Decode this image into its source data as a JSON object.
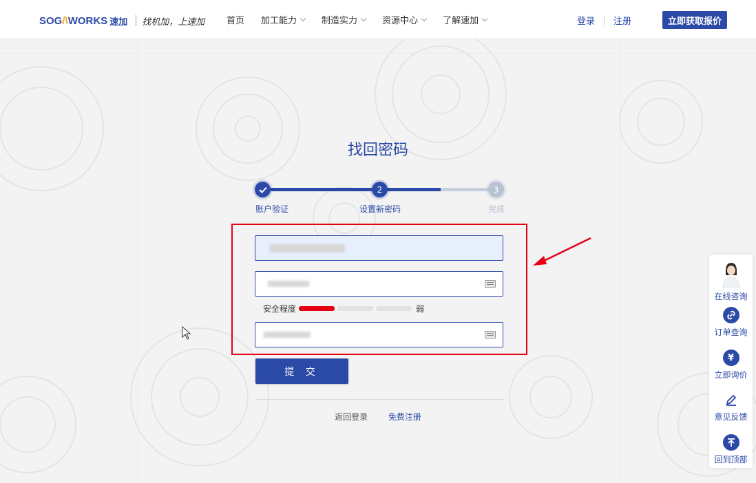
{
  "header": {
    "logo_mark_a": "SOG",
    "logo_mark_b": "WORKS",
    "logo_cn": "速加",
    "slogan": "找机加，上速加",
    "nav": [
      {
        "label": "首页",
        "has_menu": false
      },
      {
        "label": "加工能力",
        "has_menu": true
      },
      {
        "label": "制造实力",
        "has_menu": true
      },
      {
        "label": "资源中心",
        "has_menu": true
      },
      {
        "label": "了解速加",
        "has_menu": true
      }
    ],
    "login": "登录",
    "register": "注册",
    "quote_button": "立即获取报价"
  },
  "page": {
    "title": "找回密码",
    "steps": [
      {
        "num": "1",
        "label": "账户验证",
        "state": "done"
      },
      {
        "num": "2",
        "label": "设置新密码",
        "state": "current"
      },
      {
        "num": "3",
        "label": "完成",
        "state": "pending"
      }
    ],
    "strength_label": "安全程度",
    "strength_level_text": "弱",
    "strength_level": 1,
    "strength_segments": 3,
    "submit_label": "提 交",
    "back_to_login": "返回登录",
    "free_register": "免费注册"
  },
  "sidebar": {
    "items": [
      {
        "label": "在线咨询",
        "icon": "agent-avatar-icon"
      },
      {
        "label": "订单查询",
        "icon": "link-icon"
      },
      {
        "label": "立即询价",
        "icon": "yen-icon"
      },
      {
        "label": "意见反馈",
        "icon": "edit-icon"
      },
      {
        "label": "回到顶部",
        "icon": "back-to-top-icon"
      }
    ]
  },
  "colors": {
    "brand": "#2b49a6",
    "accent": "#f5a623",
    "annotation": "#e60012",
    "pending": "#b7c3d3"
  }
}
